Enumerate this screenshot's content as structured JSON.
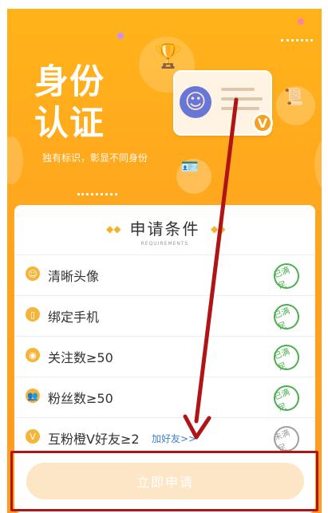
{
  "hero": {
    "title_line1": "身份",
    "title_line2": "认证",
    "subtitle": "独有标识，彰显不同身份"
  },
  "panel": {
    "title": "申请条件",
    "subtitle": "REQUIREMENTS"
  },
  "conditions": [
    {
      "label": "清晰头像",
      "status": "已满足",
      "icon": "avatar-icon"
    },
    {
      "label": "绑定手机",
      "status": "已满足",
      "icon": "phone-icon"
    },
    {
      "label": "关注数≥50",
      "status": "已满足",
      "icon": "eye-icon"
    },
    {
      "label": "粉丝数≥50",
      "status": "已满足",
      "icon": "fans-icon"
    },
    {
      "label": "互粉橙V好友≥2",
      "status": "未满足",
      "icon": "v-icon",
      "link": "加好友>>"
    }
  ],
  "submit": {
    "label": "立即申请"
  },
  "colors": {
    "hero": "#ffa51f",
    "met": "#4caf50",
    "unmet": "#9e9e9e",
    "annotation": "#b01515",
    "link": "#3f7fd1"
  }
}
